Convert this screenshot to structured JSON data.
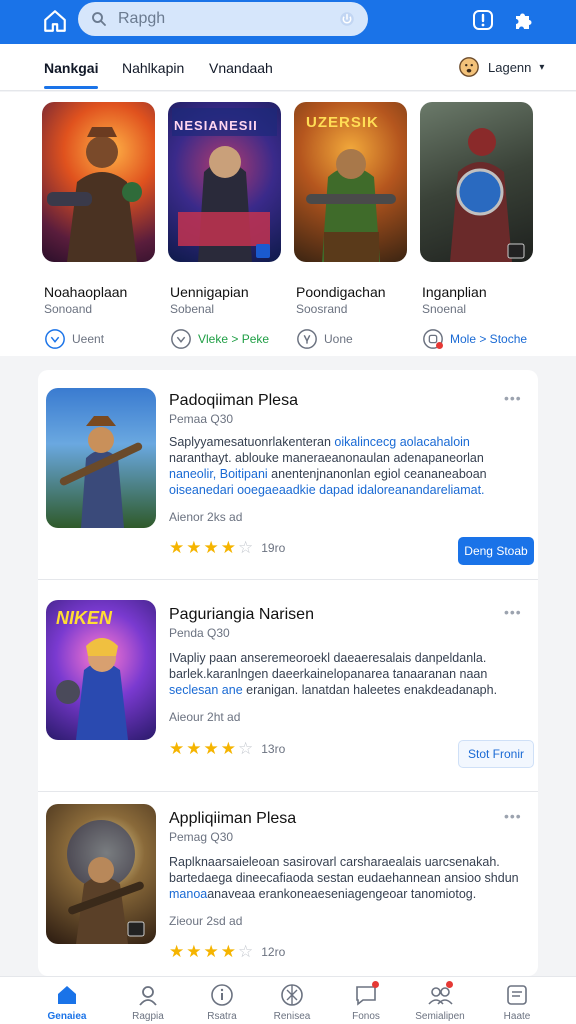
{
  "header": {
    "search_text": "Rapgh",
    "icons": {
      "home": "home-icon",
      "search": "search-icon",
      "voice": "power-icon",
      "alert": "alert-icon",
      "puzzle": "puzzle-icon"
    }
  },
  "tabs": [
    {
      "label": "Nankgai",
      "active": true
    },
    {
      "label": "Nahlkapin",
      "active": false
    },
    {
      "label": "Vnandaah",
      "active": false
    }
  ],
  "language": {
    "label": "Lagenn"
  },
  "featured": [
    {
      "name": "Noahaoplaan",
      "subtitle": "Sonoand",
      "action": "Ueent",
      "action_icon": "chevron-down-icon",
      "thumb_text": ""
    },
    {
      "name": "Uennigapian",
      "subtitle": "Sobenal",
      "action": "Vleke > Peke",
      "action_icon": "chevron-down-icon",
      "thumb_text": "NESIANESII"
    },
    {
      "name": "Poondigachan",
      "subtitle": "Soosrand",
      "action": "Uone",
      "action_icon": "settings-icon",
      "thumb_text": "UZERSIK"
    },
    {
      "name": "Inganplian",
      "subtitle": "Snoenal",
      "action": "Mole > Stoche",
      "action_icon": "app-icon",
      "thumb_text": ""
    }
  ],
  "apps": [
    {
      "title": "Padoqiiman Plesa",
      "meta": "Pemaa  Q30",
      "desc_plain": "Saplyyamesatuonrlakenteran ",
      "desc_hl1": "oikalincecg aolacahaloin",
      "desc_line2": "naranthayt. ablouke maneraeanonaulan adenapaneorlan",
      "desc_hl2": "naneolir, Boitipani",
      "desc_line3": " anentenjnanonlan egiol ceananeaboan",
      "desc_hl3": "oiseanedari ooegaeaadkie dapad idaloreanandareliamat.",
      "date": "Aienor 2ks ad",
      "stars": 4,
      "rating": "19ro",
      "button": "Deng Stoab",
      "button_style": "primary"
    },
    {
      "title": "Paguriangia Narisen",
      "meta": "Penda  Q30",
      "desc_plain": "IVapliy paan anseremeoroekl daeaeresalais danpeldanla. barlek.karanlngen daeerkainelopanarea tanaaranan naan",
      "desc_hl1": "seclesan ane",
      "desc_line2": " eranigan. lanatdan haleetes enakdeadanaph.",
      "desc_hl2": "",
      "desc_line3": "",
      "desc_hl3": "",
      "date": "Aieour 2ht ad",
      "stars": 4,
      "rating": "13ro",
      "button": "Stot Fronir",
      "button_style": "outline"
    },
    {
      "title": "Appliqiiman Plesa",
      "meta": "Pemag  Q30",
      "desc_plain": "Raplknaarsaieleoan sasirovarl carsharaealais uarcsenakah. bartedaega dineecafiaoda sestan eudaehannean ansioo shdun",
      "desc_hl1": "manoa",
      "desc_line2": "anaveaa erankoneaeseniagengeoar tanomiotog.",
      "desc_hl2": "",
      "desc_line3": "",
      "desc_hl3": "",
      "date": "Zieour 2sd ad",
      "stars": 4,
      "rating": "12ro",
      "button": "",
      "button_style": "none"
    }
  ],
  "bottom_nav": [
    {
      "label": "Genaiea",
      "icon": "home-icon",
      "active": true
    },
    {
      "label": "Ragpia",
      "icon": "user-icon",
      "active": false
    },
    {
      "label": "Rsatra",
      "icon": "info-icon",
      "active": false
    },
    {
      "label": "Renisea",
      "icon": "globe-icon",
      "active": false
    },
    {
      "label": "Fonos",
      "icon": "message-icon",
      "active": false
    },
    {
      "label": "Semialipen",
      "icon": "people-icon",
      "active": false
    },
    {
      "label": "Haate",
      "icon": "menu-icon",
      "active": false
    }
  ]
}
